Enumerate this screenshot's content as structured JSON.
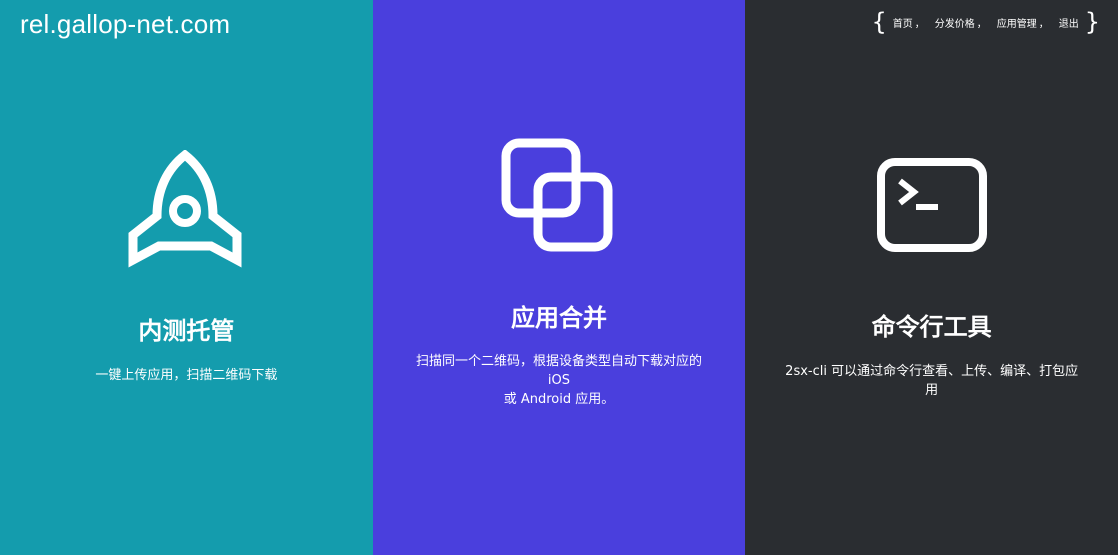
{
  "header": {
    "site_title": "rel.gallop-net.com"
  },
  "nav": {
    "brace_open": "{",
    "brace_close": "}",
    "separator": "，",
    "items": [
      {
        "label": "首页"
      },
      {
        "label": "分发价格"
      },
      {
        "label": "应用管理"
      },
      {
        "label": "退出"
      }
    ]
  },
  "panels": [
    {
      "color": "#149cad",
      "icon": "rocket-icon",
      "title": "内测托管",
      "desc_lines": [
        "一键上传应用，扫描二维码下载"
      ]
    },
    {
      "color": "#4a3fdd",
      "icon": "merge-squares-icon",
      "title": "应用合并",
      "desc_lines": [
        "扫描同一个二维码，根据设备类型自动下载对应的",
        "iOS",
        "或 Android 应用。"
      ]
    },
    {
      "color": "#2a2d31",
      "icon": "terminal-icon",
      "title": "命令行工具",
      "desc_lines": [
        "2sx-cli 可以通过命令行查看、上传、编译、打包应",
        "用"
      ]
    }
  ]
}
